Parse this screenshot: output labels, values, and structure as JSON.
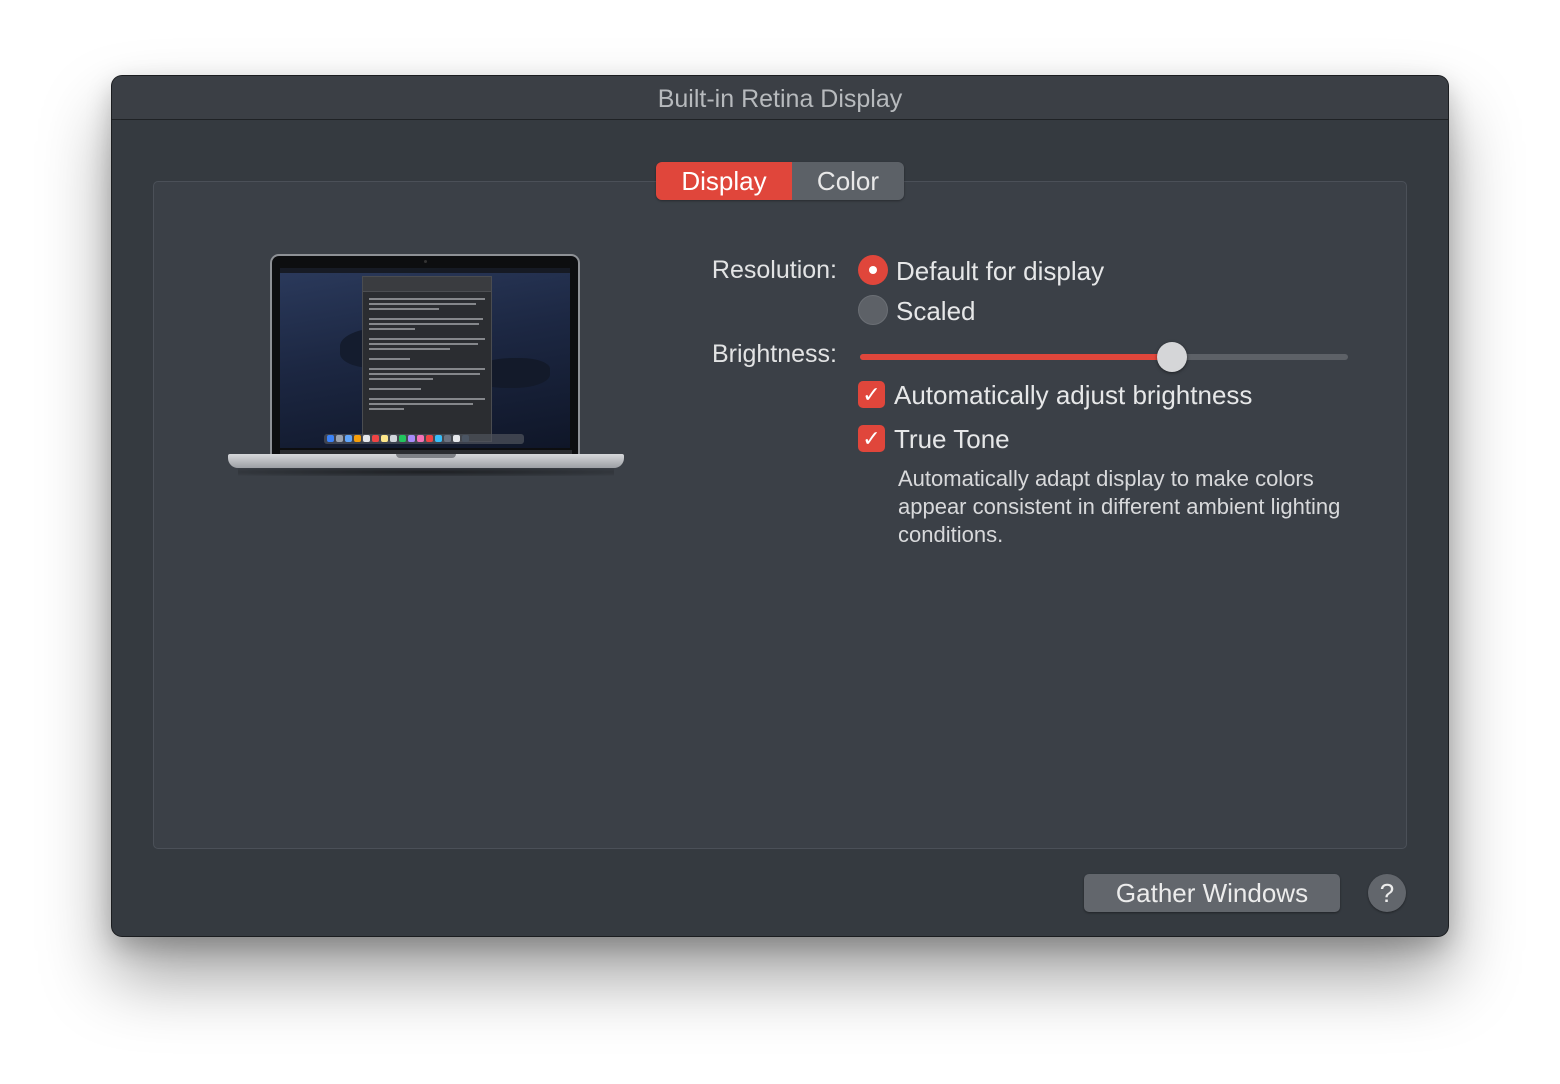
{
  "window": {
    "title": "Built-in Retina Display"
  },
  "tabs": [
    {
      "label": "Display",
      "selected": true
    },
    {
      "label": "Color",
      "selected": false
    }
  ],
  "settings": {
    "resolution_label": "Resolution:",
    "resolution_options": [
      {
        "label": "Default for display",
        "selected": true
      },
      {
        "label": "Scaled",
        "selected": false
      }
    ],
    "brightness_label": "Brightness:",
    "brightness_level": 0.64,
    "auto_brightness": {
      "label": "Automatically adjust brightness",
      "checked": true
    },
    "true_tone": {
      "label": "True Tone",
      "checked": true,
      "description": "Automatically adapt display to make colors appear consistent in different ambient lighting conditions."
    }
  },
  "footer": {
    "gather_label": "Gather Windows",
    "help_label": "?"
  },
  "colors": {
    "accent": "#e0463b",
    "window_bg": "#353a40",
    "panel_bg": "#3b4047"
  },
  "icons": [
    "macbook-illustration",
    "checkmark-icon",
    "help-icon"
  ]
}
